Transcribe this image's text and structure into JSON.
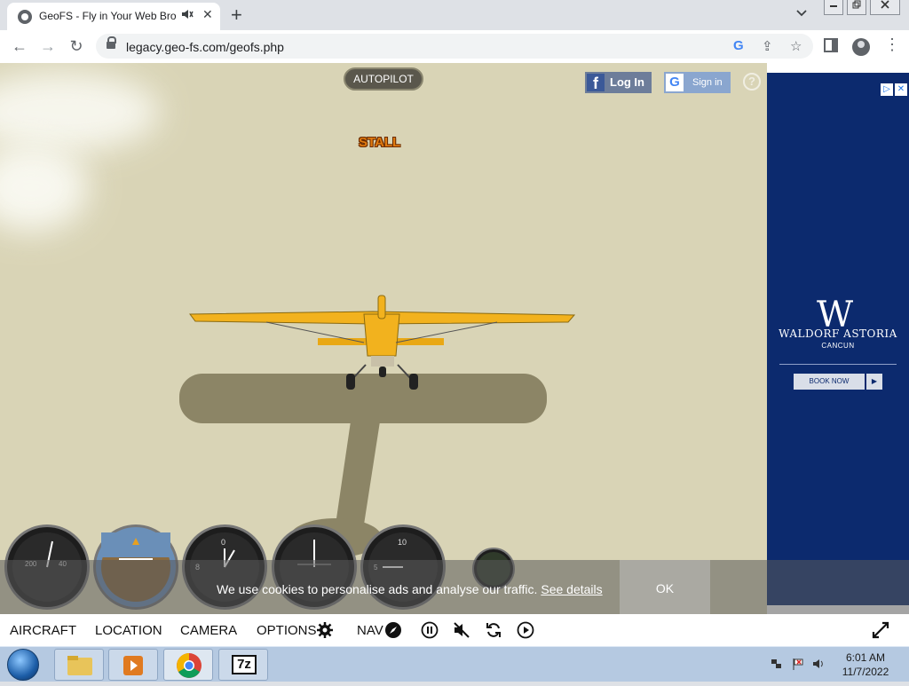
{
  "browser": {
    "tab_title": "GeoFS - Fly in Your Web Bro",
    "tab_audio_icon": "speaker-icon",
    "tab_close": "✕",
    "new_tab": "+",
    "tab_search": "⌄",
    "url": "legacy.geo-fs.com/geofs.php",
    "window_controls": [
      "▭",
      "❐",
      "✕"
    ],
    "nav": {
      "back": "←",
      "forward": "→",
      "reload": "↻"
    },
    "omnibox_icons": {
      "google": "G",
      "share": "⇪",
      "bookmark": "☆"
    },
    "toolbar_icons": {
      "side_panel": "▯",
      "menu": "⋮"
    }
  },
  "sim": {
    "autopilot_label": "AUTOPILOT",
    "stall_warning": "STALL",
    "facebook_login": "Log In",
    "google_signin": "Sign in",
    "help": "?",
    "cookie_text": "We use cookies to personalise ads and analyse our traffic.",
    "cookie_link": "See details",
    "cookie_ok": "OK",
    "menu": {
      "aircraft": "AIRCRAFT",
      "location": "LOCATION",
      "camera": "CAMERA",
      "options": "OPTIONS",
      "nav": "NAV"
    },
    "gauges": [
      "airspeed",
      "attitude",
      "altimeter",
      "heading",
      "vertical-speed",
      "fuel"
    ]
  },
  "ad": {
    "brand": "WALDORF ASTORIA",
    "location": "CANCUN",
    "cta": "BOOK NOW",
    "cta_arrow": "▶",
    "logo": "W"
  },
  "taskbar": {
    "time": "6:01 AM",
    "date": "11/7/2022",
    "app_7z": "7z"
  },
  "colors": {
    "sky": "#d9d4b6",
    "plane": "#f2b21e",
    "shadow": "#8c8566",
    "ad_bg": "#0c2a6e",
    "stall": "#e07a10"
  }
}
